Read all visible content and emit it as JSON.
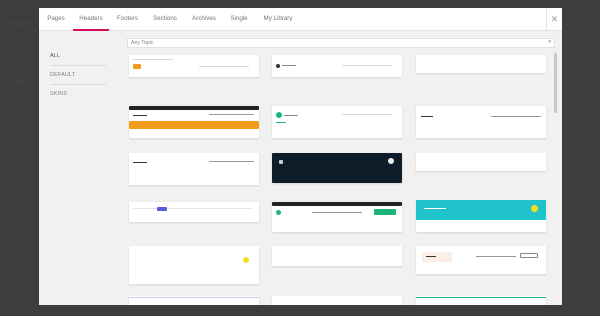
{
  "tabs": [
    {
      "label": "Pages"
    },
    {
      "label": "Headers"
    },
    {
      "label": "Footers"
    },
    {
      "label": "Sections"
    },
    {
      "label": "Archives"
    },
    {
      "label": "Single"
    },
    {
      "label": "My Library"
    }
  ],
  "close_glyph": "✕",
  "sidebar": {
    "items": [
      {
        "label": "ALL"
      },
      {
        "label": "DEFAULT"
      },
      {
        "label": "SKINS"
      }
    ]
  },
  "filter": {
    "value": "Any Topic",
    "caret": "▾"
  },
  "colors": {
    "accent": "#d30c5c",
    "orange": "#f49a1a",
    "dark_navy": "#0f1d2b",
    "teal": "#1fc3c9",
    "green": "#1bb57a",
    "yellow": "#f2e11a"
  }
}
